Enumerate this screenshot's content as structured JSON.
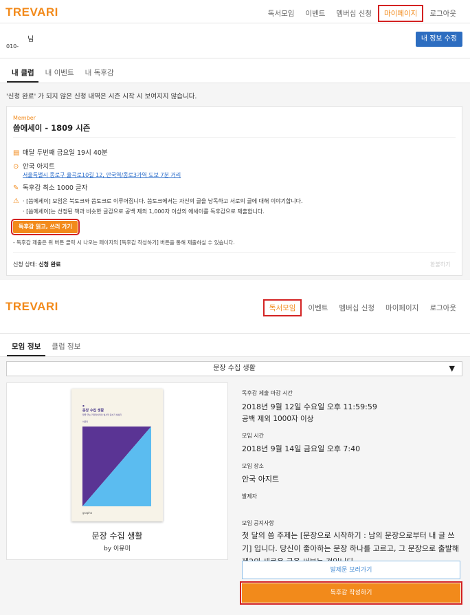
{
  "screen1": {
    "logo": "TREVARI",
    "nav": [
      "독서모임",
      "이벤트",
      "멤버십 신청",
      "마이페이지",
      "로그아웃"
    ],
    "user": {
      "name": "님",
      "phone": "010-"
    },
    "edit_button": "내 정보 수정",
    "tabs": [
      "내 클럽",
      "내 이벤트",
      "내 독후감"
    ],
    "notice": "'신청 완료' 가 되지 않은 신청 내역은 시즌 시작 시 보여지지 않습니다.",
    "card": {
      "role": "Member",
      "title": "씀에세이 - 1809 시즌",
      "schedule": "매달 두번째 금요일 19시 40분",
      "place_name": "안국 아지트",
      "place_address": "서울특별시 종로구 율곡로10길 12, 안국역/종로3가역 도보 7분 거리",
      "min_length": "독후감 최소 1000 글자",
      "rule1": "· [씀에세이] 모임은 북토크와 씀토크로 이루어집니다. 씀토크에서는 자신의 글을 낭독하고 서로의 글에 대해 이야기합니다.",
      "rule2": "· [씀에세이]는 선정된 책과 비슷한 글감으로 공백 제외 1,000자 이상의 에세이를 독후감으로 제출합니다.",
      "essay_button": "독후감 읽고, 쓰러 가기",
      "essay_note": "- 독후감 제출은 위 버튼 클릭 시 나오는 페이지의 [독후감 작성하기] 버튼을 통해 제출하실 수 있습니다.",
      "status_label": "신청 상태:",
      "status_value": "신청 완료",
      "refund": "환불하기"
    }
  },
  "screen2": {
    "logo": "TREVARI",
    "nav": [
      "독서모임",
      "이벤트",
      "멤버십 신청",
      "마이페이지",
      "로그아웃"
    ],
    "tabs": [
      "모임 정보",
      "클럽 정보"
    ],
    "dropdown": "문장 수집 생활",
    "book": {
      "cover_title": "문장 수집 생활",
      "cover_subtitle": "밑줄 긋는 카피라이터의 필사적 글쓰기 필살기",
      "cover_author": "이유미",
      "cover_publisher": "grapho",
      "title": "문장 수집 생활",
      "author": "by 이유미"
    },
    "info": {
      "deadline_label": "독후감 제출 마감 시간",
      "deadline_value": "2018년 9월 12일 수요일 오후 11:59:59",
      "deadline_note": "공백 제외 1000자 이상",
      "time_label": "모임 시간",
      "time_value": "2018년 9월 14일 금요일 오후 7:40",
      "place_label": "모임 장소",
      "place_value": "안국 아지트",
      "presenter_label": "발제자",
      "notice_label": "모임 공지사항",
      "notice_text": "첫 달의 씀 주제는 [문장으로 시작하기 : 남의 문장으로부터 내 글 쓰기] 입니다. 당신이 좋아하는 문장 하나를 고르고, 그 문장으로 출발해 제2의 새로운 글을 써보는 것입니다.",
      "view_button": "발제문 보러가기",
      "write_button": "독후감 작성하기"
    }
  },
  "colors": {
    "accent": "#f28a1b",
    "blue": "#2d6dc0",
    "highlight": "#d32222"
  }
}
